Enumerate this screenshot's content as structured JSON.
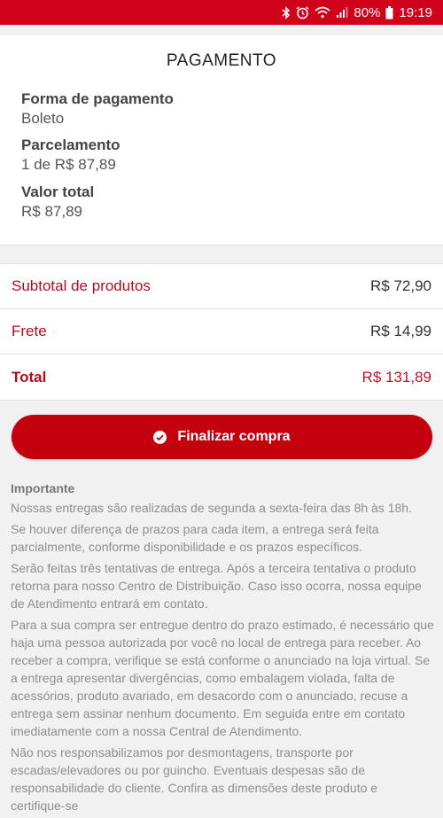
{
  "status_bar": {
    "battery": "80%",
    "time": "19:19",
    "icons": [
      "bluetooth-icon",
      "alarm-icon",
      "wifi-icon",
      "signal-icon",
      "battery-icon"
    ]
  },
  "payment": {
    "title": "PAGAMENTO",
    "method_label": "Forma de pagamento",
    "method_value": "Boleto",
    "installments_label": "Parcelamento",
    "installments_value": "1 de R$ 87,89",
    "total_label": "Valor total",
    "total_value": "R$ 87,89"
  },
  "summary": {
    "subtotal_label": "Subtotal de produtos",
    "subtotal_value": "R$ 72,90",
    "shipping_label": "Frete",
    "shipping_value": "R$ 14,99",
    "total_label": "Total",
    "total_value": "R$ 131,89"
  },
  "finalize_button": {
    "label": "Finalizar compra",
    "icon": "check-circle-icon"
  },
  "info": {
    "heading": "Importante",
    "p1": "Nossas entregas são realizadas de segunda a sexta-feira das 8h às 18h.",
    "p2": "Se houver diferença de prazos para cada item, a entrega será feita parcialmente, conforme disponibilidade e os prazos específicos.",
    "p3": "Serão feitas três tentativas de entrega. Após a terceira tentativa o produto retorna para nosso Centro de Distribuição. Caso isso ocorra, nossa equipe de Atendimento entrará em contato.",
    "p4": "Para a sua compra ser entregue dentro do prazo estimado, é necessário que haja uma pessoa autorizada por você no local de entrega para receber. Ao receber a compra, verifique se está conforme o anunciado na loja virtual. Se a entrega apresentar divergências, como embalagem violada, falta de acessórios, produto avariado, em desacordo com o anunciado, recuse a entrega sem assinar nenhum documento. Em seguida entre em contato imediatamente com a nossa Central de Atendimento.",
    "p5": "Não nos responsabilizamos por desmontagens, transporte por escadas/elevadores ou por guincho. Eventuais despesas são de responsabilidade do cliente. Confira as dimensões deste produto e certifique-se"
  },
  "colors": {
    "brand_red": "#d0021b",
    "button_red": "#c4000f",
    "label_red": "#b20d1e"
  }
}
